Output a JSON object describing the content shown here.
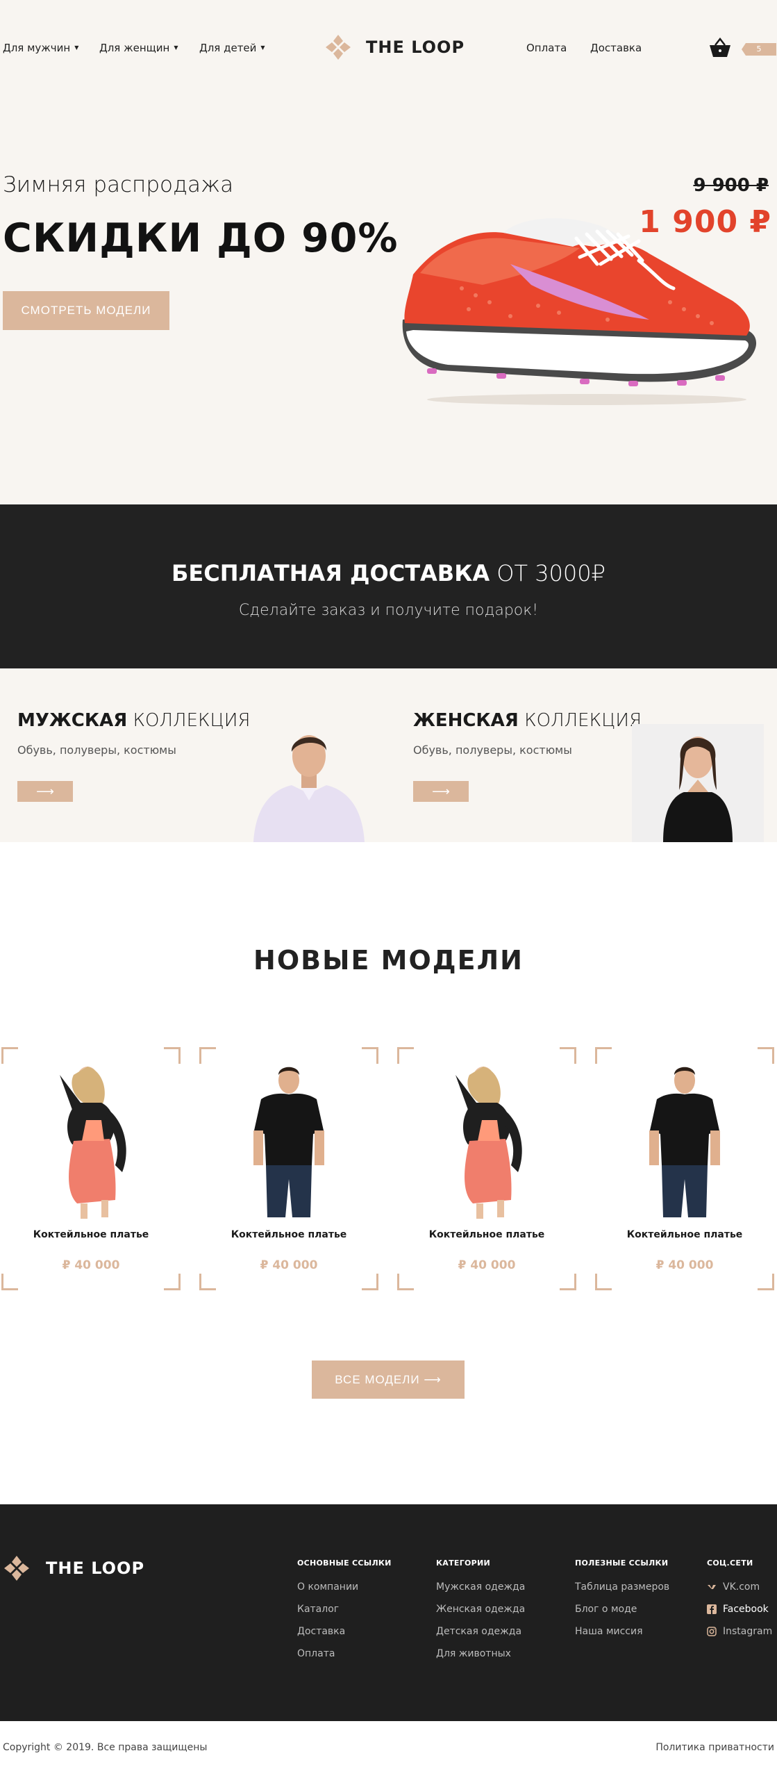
{
  "header": {
    "nav_left": [
      "Для мужчин",
      "Для женщин",
      "Для детей"
    ],
    "logo": "THE LOOP",
    "nav_right": [
      "Оплата",
      "Доставка"
    ],
    "cart_count": "5"
  },
  "hero": {
    "subtitle": "Зимняя распродажа",
    "title": "СКИДКИ ДО 90%",
    "button": "СМОТРЕТЬ МОДЕЛИ",
    "old_price": "9 900 ₽",
    "new_price": "1 900 ₽"
  },
  "banner": {
    "title_bold": "БЕСПЛАТНАЯ ДОСТАВКА",
    "title_light": "ОТ 3000₽",
    "subtitle": "Сделайте заказ и получите подарок!"
  },
  "collections": [
    {
      "bold": "МУЖСКАЯ",
      "light": "КОЛЛЕКЦИЯ",
      "subtitle": "Обувь, полуверы, костюмы",
      "arrow": "⟶"
    },
    {
      "bold": "ЖЕНСКАЯ",
      "light": "КОЛЛЕКЦИЯ",
      "subtitle": "Обувь, полуверы, костюмы",
      "arrow": "⟶"
    }
  ],
  "new_models": {
    "title": "НОВЫЕ МОДЕЛИ",
    "products": [
      {
        "name": "Коктейльное платье",
        "price": "₽ 40 000"
      },
      {
        "name": "Коктейльное платье",
        "price": "₽ 40 000"
      },
      {
        "name": "Коктейльное платье",
        "price": "₽ 40 000"
      },
      {
        "name": "Коктейльное платье",
        "price": "₽ 40 000"
      }
    ],
    "all_button": "ВСЕ МОДЕЛИ ⟶"
  },
  "footer": {
    "logo": "THE LOOP",
    "columns": [
      {
        "title": "ОСНОВНЫЕ ССЫЛКИ",
        "links": [
          "О компании",
          "Каталог",
          "Доставка",
          "Оплата"
        ]
      },
      {
        "title": "КАТЕГОРИИ",
        "links": [
          "Мужская одежда",
          "Женская одежда",
          "Детская одежда",
          "Для животных"
        ]
      },
      {
        "title": "ПОЛЕЗНЫЕ ССЫЛКИ",
        "links": [
          "Таблица размеров",
          "Блог о моде",
          "Наша миссия"
        ]
      },
      {
        "title": "СОЦ.СЕТИ",
        "links": [
          "VK.com",
          "Facebook",
          "Instagram"
        ]
      }
    ],
    "social_icons": [
      "vk-icon",
      "facebook-icon",
      "instagram-icon"
    ]
  },
  "bottom": {
    "copyright": "Copyright © 2019. Все права защищены",
    "policy": "Политика приватности"
  },
  "colors": {
    "accent": "#dbb79c",
    "dark": "#222222",
    "light_bg": "#f8f5f1",
    "price_red": "#e2432b"
  }
}
